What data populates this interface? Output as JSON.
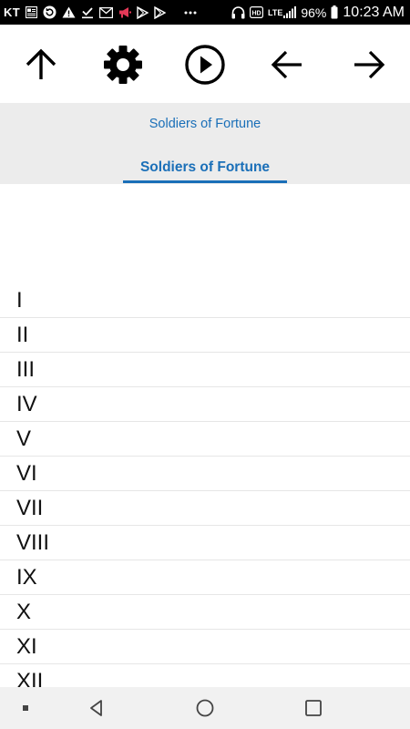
{
  "status_bar": {
    "carrier": "KT",
    "network": "LTE",
    "battery": "96%",
    "time": "10:23 AM",
    "left_icons": [
      "news-icon",
      "refresh-icon",
      "warning-icon",
      "check-download-icon",
      "gmail-icon",
      "megaphone-icon",
      "play-store-icon",
      "play-store-icon",
      "more-dots-icon"
    ],
    "right_icons": [
      "headphones-icon",
      "hd-icon",
      "signal-icon",
      "battery-icon"
    ]
  },
  "toolbar": {
    "buttons": [
      "up-arrow-icon",
      "gear-icon",
      "play-circle-icon",
      "back-arrow-icon",
      "forward-arrow-icon"
    ]
  },
  "header": {
    "title": "Soldiers of Fortune",
    "tab_label": "Soldiers of Fortune"
  },
  "chapters": [
    "I",
    "II",
    "III",
    "IV",
    "V",
    "VI",
    "VII",
    "VIII",
    "IX",
    "X",
    "XI",
    "XII"
  ],
  "nav_bar": {
    "buttons": [
      "menu-dot-icon",
      "back-triangle-icon",
      "home-circle-icon",
      "recents-square-icon"
    ]
  },
  "colors": {
    "accent": "#1a6fb8",
    "header_bg": "#ececec",
    "status_bar_bg": "#000000",
    "nav_bar_bg": "#f1f1f1",
    "megaphone": "#e53958"
  }
}
